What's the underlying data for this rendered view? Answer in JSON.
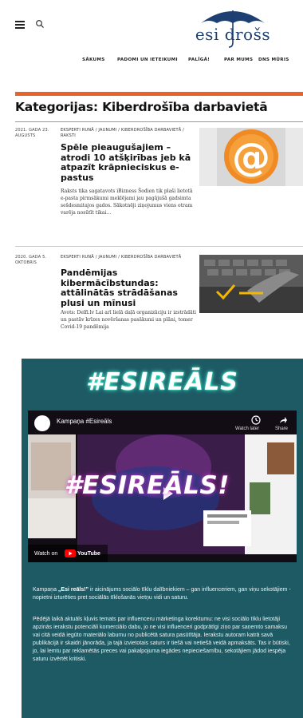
{
  "header": {
    "logo_text": "esi drošs",
    "nav": [
      "SĀKUMS",
      "PADOMI UN IETEIKUMI",
      "PALĪGĀ!",
      "PAR MUMS",
      "DNS MŪRIS"
    ]
  },
  "page": {
    "title": "Kategorijas: Kiberdrošība darbavietā"
  },
  "articles": [
    {
      "date": "2021. GADA 23. AUGUSTS",
      "categories": "EKSPERTI RUNĀ / JAUNUMI / KIBERDROŠĪBA DARBAVIETĀ / RAKSTI",
      "title": "Spēle pieaugušajiem – atrodi 10 atšķirības jeb kā atpazīt krāpnieciskus e-pastus",
      "excerpt": "Raksts tika sagatavots iBizness Šodien tik plaši lietotā e-pasta pirmsākumi meklējami jau pagājušā gadsimta sešdesmitajos gados. Sākotnēji ziņojumus viens otram varēja nosūtīt tikai…",
      "image_icon": "at-sign-icon"
    },
    {
      "date": "2020. GADA 5. OKTOBRIS",
      "categories": "EKSPERTI RUNĀ / JAUNUMI / KIBERDROŠĪBA DARBAVIETĀ",
      "title": "Pandēmijas kibermācībstundas: attālinātās strādāšanas plusi un mīnusi",
      "excerpt": "Avots: Delfi.lv Lai arī lielā daļā organizāciju ir izstrādāti un pastāv krīzes novēršanas pasākumi un plāni, tomer Covid-19 pandēmija",
      "image_icon": "keyboard-check-icon"
    }
  ],
  "promo": {
    "logo_text": "#ESIREĀLS",
    "video": {
      "title": "Kampaņa #Esireāls",
      "overlay_text": "#ESIREĀLS!",
      "watch_later": "Watch later",
      "share": "Share",
      "watch_on": "Watch on",
      "youtube": "YouTube"
    },
    "paragraph1_before": "Kampaņa ",
    "paragraph1_bold": "„Esi reāls!”",
    "paragraph1_after": " ir aicinājums sociālo tīklu dalībniekiem – gan influenceriem, gan viņu sekotājiem - nopietni izturēties pret sociālās tīklošanās vietņu vidi un saturu.",
    "paragraph2": "Pēdējā laikā aktuāls kļuvis temats par influenceru mārketinga korektumu: ne visi sociālo tīklu lietotāji apzinās ierakstu potenciāli komerciālo dabu, jo ne visi influenceri godprātīgi ziņo par saņemto samaksu vai citā veidā iegūto materiālo labumu no publicētā satura pasūtītāja. Ierakstu autoram katrā savā publikācijā ir skaidri jānorāda, ja tajā izvietotais saturs ir tiešā vai netiešā veidā apmaksāts. Tas ir būtiski, jo, lai lemtu par reklamētās preces vai pakalpojuma iegādes nepieciešamību, sekotājiem jādod iespēja saturu izvērtēt kritiski."
  },
  "colors": {
    "accent": "#e8622b",
    "brand_blue": "#1d3f72",
    "promo_bg": "#1e5a64"
  }
}
